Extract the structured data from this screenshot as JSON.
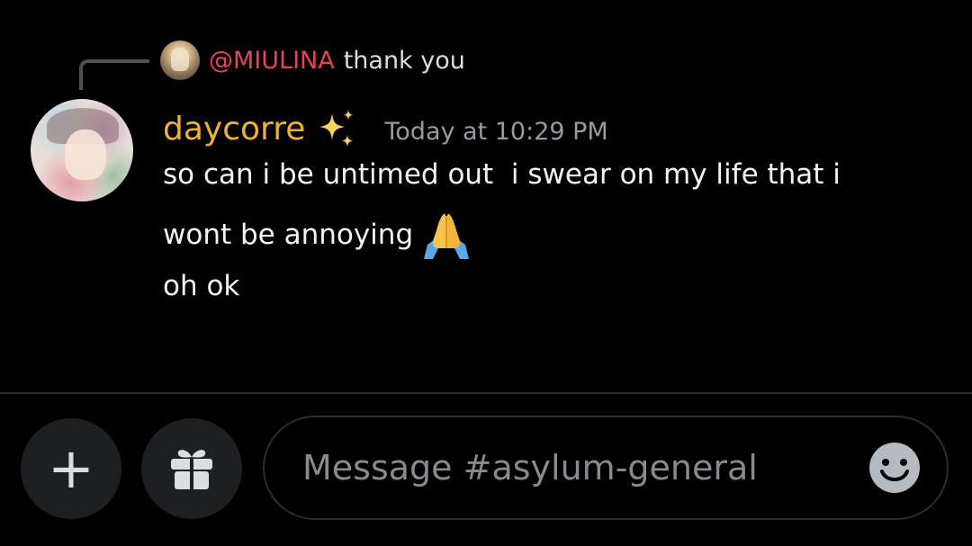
{
  "reply": {
    "mention": "@MIULINA",
    "text": "thank you"
  },
  "message": {
    "author": "daycorre",
    "timestamp": "Today at 10:29 PM",
    "lines": [
      "so can i be untimed out  i swear on my life that i",
      "wont be annoying",
      "oh ok"
    ],
    "emoji": "folded-hands"
  },
  "composer": {
    "placeholder": "Message #asylum-general",
    "plus_label": "+"
  },
  "colors": {
    "username": "#f0b232",
    "mention": "#e8425d",
    "timestamp": "#949ba4",
    "background": "#000000",
    "button_bg": "#1e1f22"
  }
}
